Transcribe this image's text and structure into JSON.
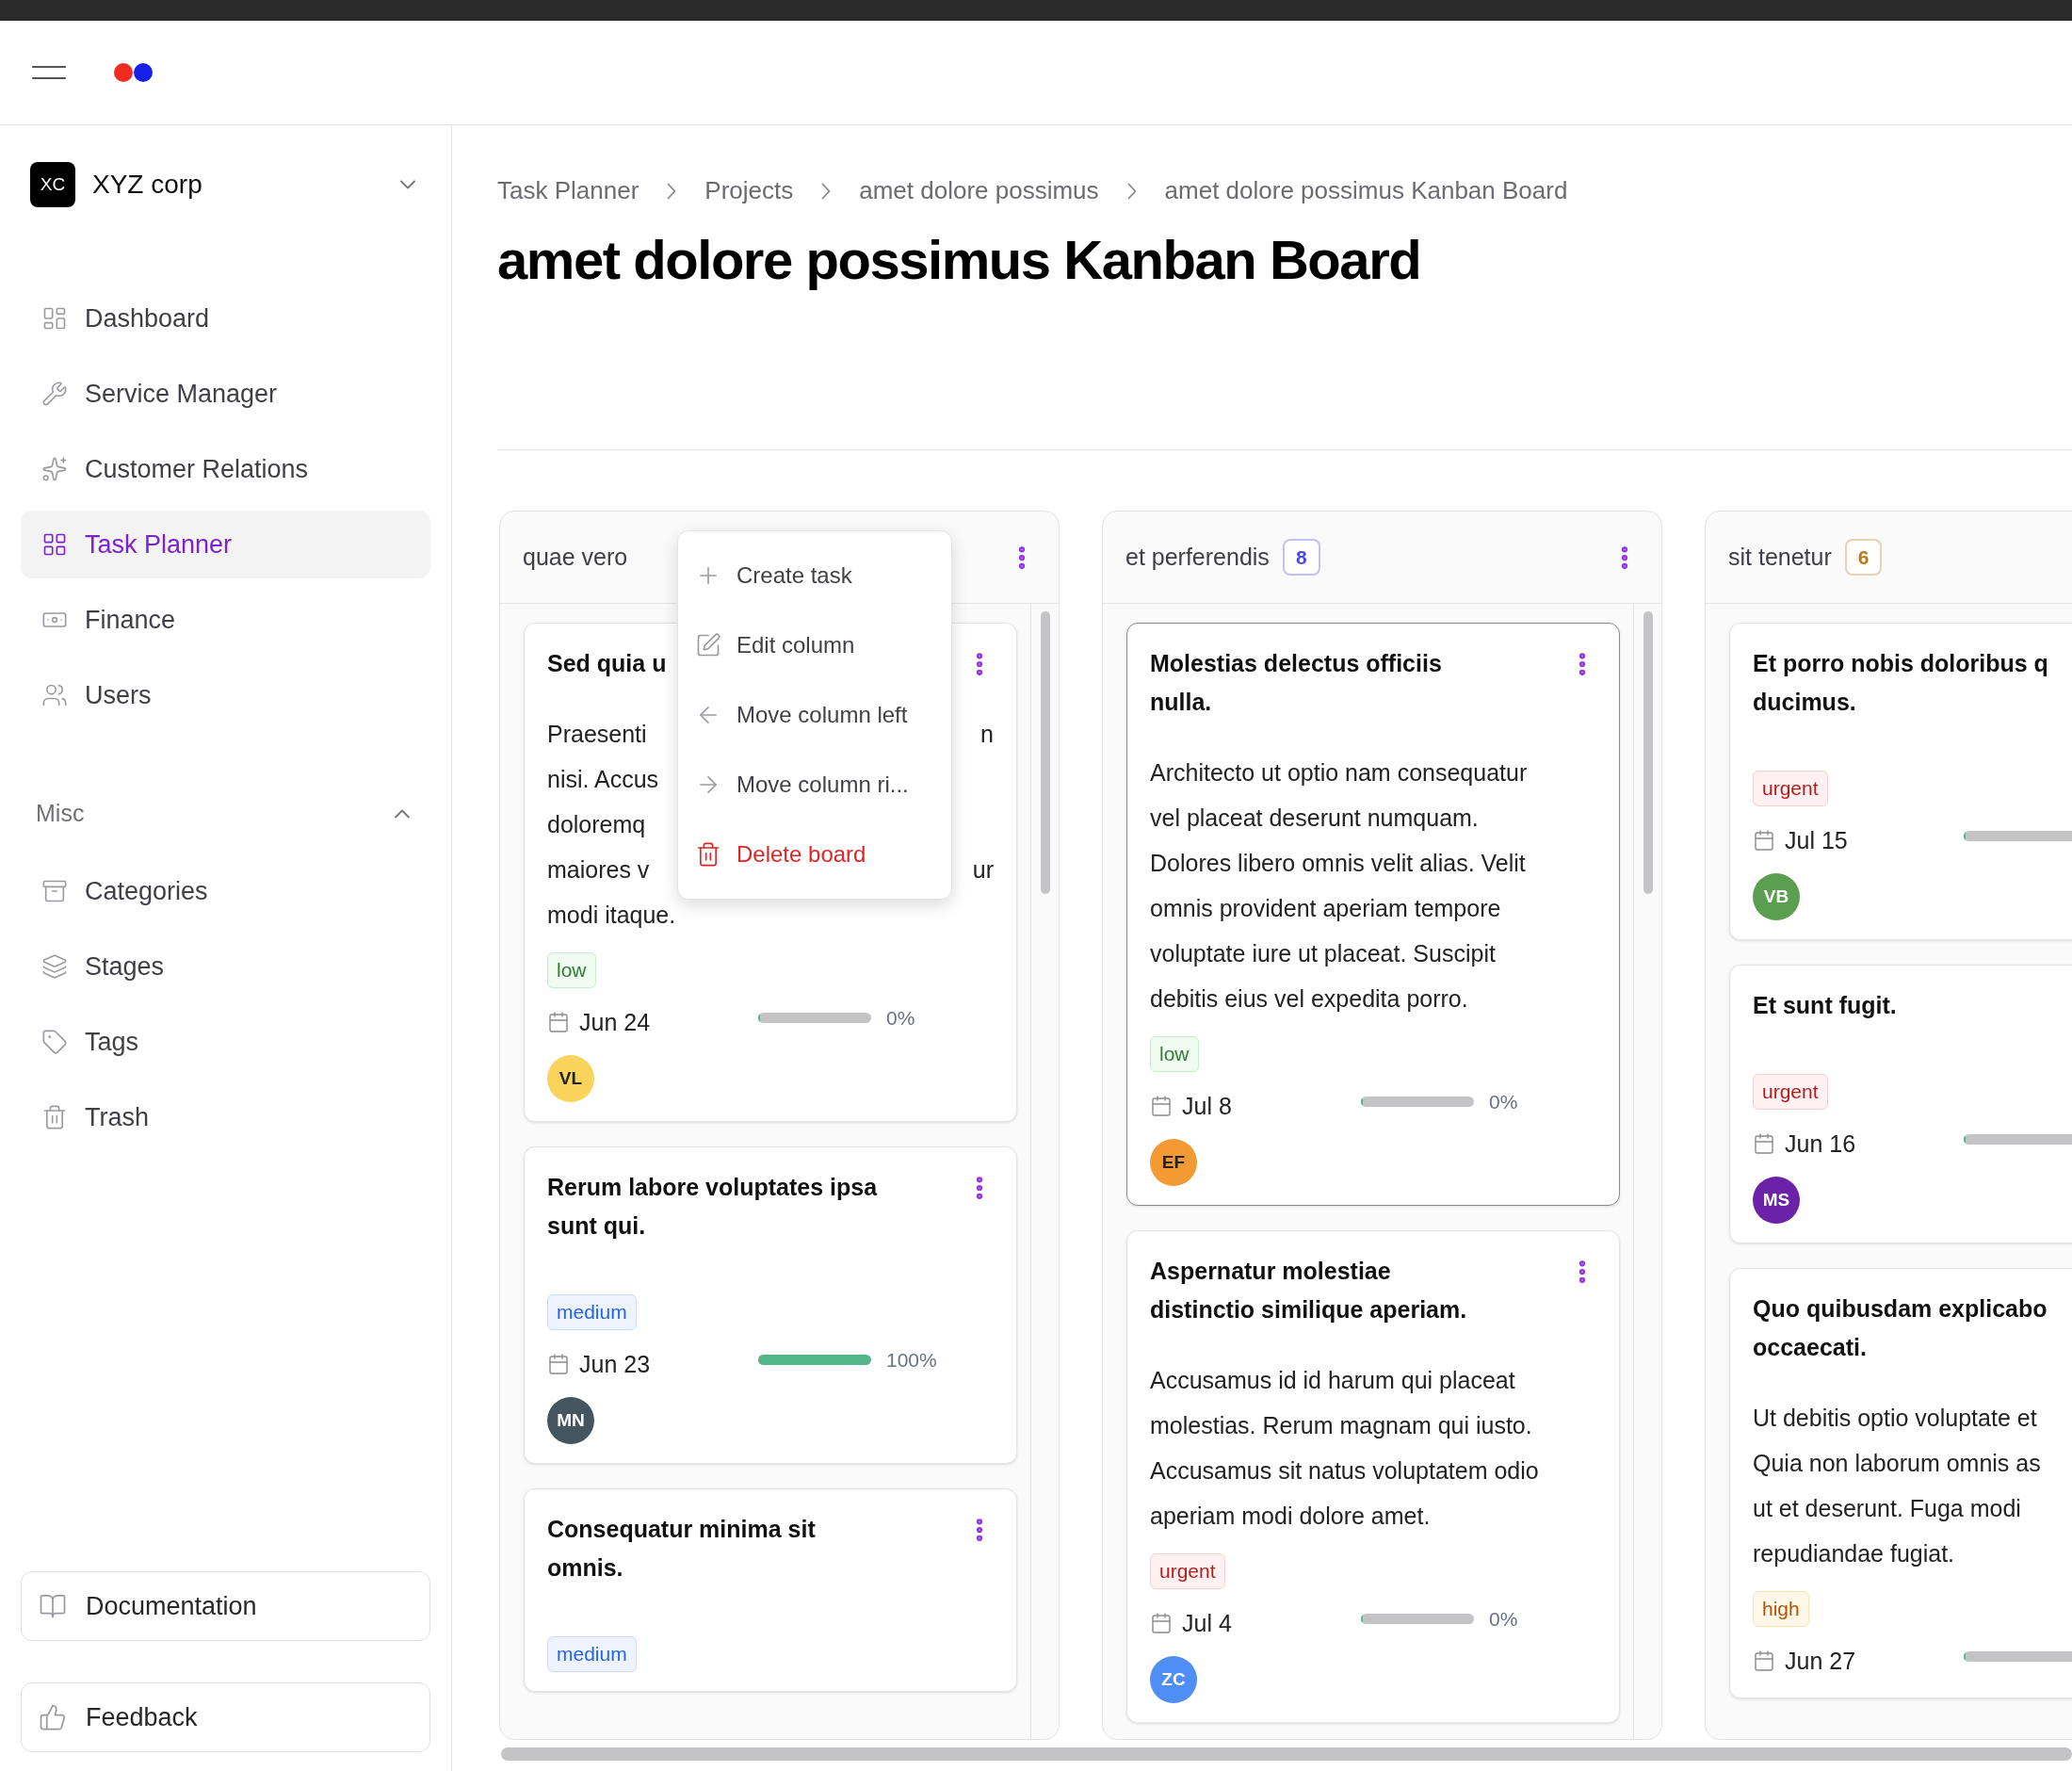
{
  "sidebar": {
    "org": {
      "initials": "XC",
      "name": "XYZ corp"
    },
    "items": [
      {
        "label": "Dashboard",
        "selected": false
      },
      {
        "label": "Service Manager",
        "selected": false
      },
      {
        "label": "Customer Relations",
        "selected": false
      },
      {
        "label": "Task Planner",
        "selected": true
      },
      {
        "label": "Finance",
        "selected": false
      },
      {
        "label": "Users",
        "selected": false
      }
    ],
    "section": {
      "label": "Misc",
      "expanded": true,
      "items": [
        {
          "label": "Categories",
          "selected": false
        },
        {
          "label": "Stages",
          "selected": false
        },
        {
          "label": "Tags",
          "selected": false
        },
        {
          "label": "Trash",
          "selected": false
        }
      ]
    },
    "footer_buttons": [
      "Documentation",
      "Feedback"
    ]
  },
  "breadcrumb": [
    "Task Planner",
    "Projects",
    "amet dolore possimus",
    "amet dolore possimus Kanban Board"
  ],
  "title": "amet dolore possimus Kanban Board",
  "column_menu": {
    "items": [
      {
        "label": "Create task",
        "kind": "normal"
      },
      {
        "label": "Edit column",
        "kind": "normal"
      },
      {
        "label": "Move column left",
        "kind": "normal"
      },
      {
        "label": "Move column ri...",
        "kind": "normal"
      },
      {
        "label": "Delete board",
        "kind": "danger"
      }
    ]
  },
  "columns": [
    {
      "title": "quae vero",
      "menu_open": true,
      "cards": [
        {
          "title": [
            "Sed quia u"
          ],
          "selected": false,
          "lines": [
            [
              "Praesenti",
              "n"
            ],
            [
              "nisi. Accus"
            ],
            [
              "doloremq"
            ],
            [
              "maiores v",
              "ur"
            ],
            [
              "modi itaque."
            ]
          ],
          "tag": {
            "label": "low",
            "kind": "low"
          },
          "date": "Jun 24",
          "progress": {
            "level": 0,
            "reading": "0%"
          },
          "avatar": {
            "initials": "VL",
            "color": "#f9d35b"
          }
        },
        {
          "title": [
            "Rerum labore voluptates ipsa",
            "sunt qui."
          ],
          "selected": false,
          "tag": {
            "label": "medium",
            "kind": "medium"
          },
          "date": "Jun 23",
          "progress": {
            "level": 1,
            "reading": "100%"
          },
          "avatar": {
            "initials": "MN",
            "color": "#455560"
          }
        },
        {
          "title": [
            "Consequatur minima sit",
            "omnis."
          ],
          "selected": false,
          "tag": {
            "label": "medium",
            "kind": "medium"
          }
        }
      ]
    },
    {
      "title": "et perferendis",
      "menu_open": false,
      "count": {
        "label": "8",
        "color": "#4f46e5"
      },
      "cards": [
        {
          "title": [
            "Molestias delectus officiis",
            "nulla."
          ],
          "selected": true,
          "lines": [
            [
              "Architecto ut optio nam consequatur"
            ],
            [
              "vel placeat deserunt numquam."
            ],
            [
              "Dolores libero omnis velit alias. Velit"
            ],
            [
              "omnis provident aperiam tempore"
            ],
            [
              "voluptate iure ut placeat. Suscipit"
            ],
            [
              "debitis eius vel expedita porro."
            ]
          ],
          "tag": {
            "label": "low",
            "kind": "low"
          },
          "date": "Jul 8",
          "progress": {
            "level": 0,
            "reading": "0%"
          },
          "avatar": {
            "initials": "EF",
            "color": "#f39a35"
          }
        },
        {
          "title": [
            "Aspernatur molestiae",
            "distinctio similique aperiam."
          ],
          "selected": false,
          "lines": [
            [
              "Accusamus id id harum qui placeat"
            ],
            [
              "molestias. Rerum magnam qui iusto."
            ],
            [
              "Accusamus sit natus voluptatem odio"
            ],
            [
              "aperiam modi dolore amet."
            ]
          ],
          "tag": {
            "label": "urgent",
            "kind": "urgent"
          },
          "date": "Jul 4",
          "progress": {
            "level": 0,
            "reading": "0%"
          },
          "avatar": {
            "initials": "ZC",
            "color": "#4f8ef7"
          }
        }
      ]
    },
    {
      "title": "sit tenetur",
      "menu_open": false,
      "count": {
        "label": "6",
        "color": "#b7791f"
      },
      "cards": [
        {
          "title": [
            "Et porro nobis doloribus q",
            "ducimus."
          ],
          "selected": false,
          "tag": {
            "label": "urgent",
            "kind": "urgent"
          },
          "date": "Jul 15",
          "progress": {
            "level": 0
          },
          "avatar": {
            "initials": "VB",
            "color": "#5a9e4f"
          }
        },
        {
          "title": [
            "Et sunt fugit."
          ],
          "selected": false,
          "tag": {
            "label": "urgent",
            "kind": "urgent"
          },
          "date": "Jun 16",
          "progress": {
            "level": 0
          },
          "avatar": {
            "initials": "MS",
            "color": "#6b21a8"
          }
        },
        {
          "title": [
            "Quo quibusdam explicabo",
            "occaecati."
          ],
          "selected": false,
          "lines": [
            [
              "Ut debitis optio voluptate et"
            ],
            [
              "Quia non laborum omnis as"
            ],
            [
              "ut et deserunt. Fuga modi"
            ],
            [
              "repudiandae fugiat."
            ]
          ],
          "tag": {
            "label": "high",
            "kind": "high"
          },
          "date": "Jun 27",
          "progress": {
            "level": 0
          }
        }
      ]
    }
  ]
}
